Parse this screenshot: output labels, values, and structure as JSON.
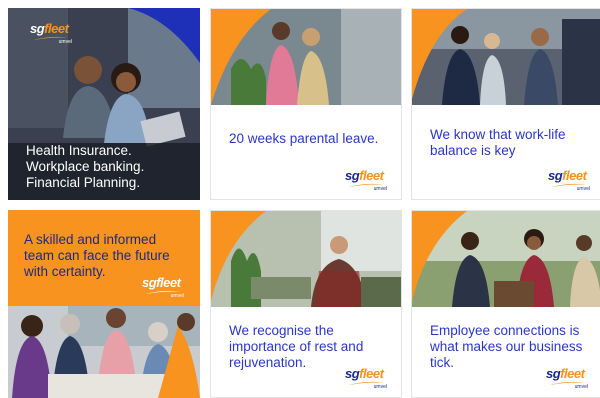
{
  "brand": {
    "name_prefix": "sg",
    "name_suffix": "fleet",
    "tagline": "umvel"
  },
  "colors": {
    "orange": "#f7931e",
    "blue": "#2b36c8",
    "navy": "#1b2a8a",
    "white": "#ffffff"
  },
  "tiles": [
    {
      "caption_lines": [
        "Health Insurance.",
        "Workplace banking.",
        "Financial Planning."
      ]
    },
    {
      "caption_lines": [
        "20 weeks parental leave."
      ]
    },
    {
      "caption_lines": [
        "We know that work-life",
        "balance is key"
      ]
    },
    {
      "caption_lines": [
        "A skilled and informed",
        "team can face the future",
        "with certainty."
      ]
    },
    {
      "caption_lines": [
        "We recognise the",
        "importance of rest and",
        "rejuvenation."
      ]
    },
    {
      "caption_lines": [
        "Employee connections is",
        "what makes our business",
        "tick."
      ]
    }
  ]
}
